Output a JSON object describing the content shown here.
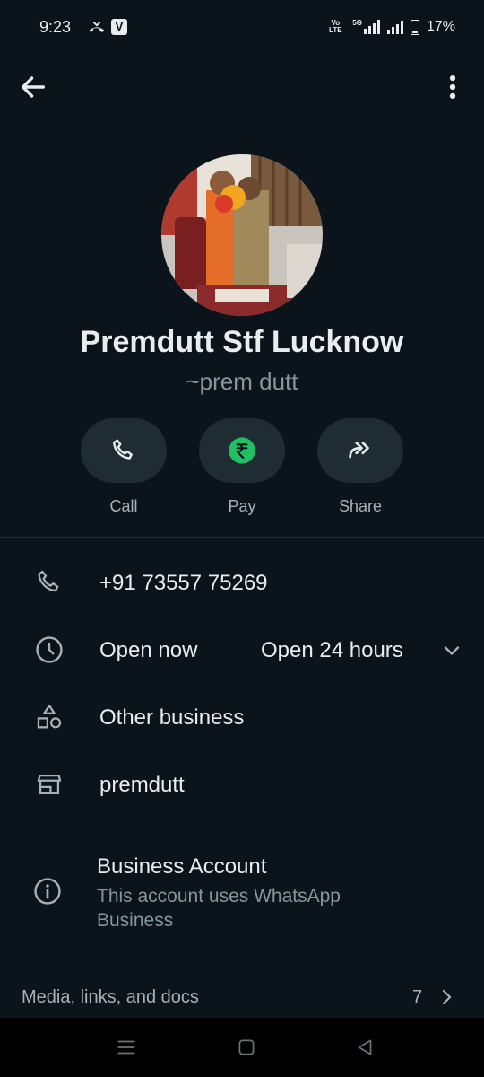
{
  "status_bar": {
    "time": "9:23",
    "network_label": "5G",
    "volte_label": "Vo LTE",
    "battery": "17%"
  },
  "profile": {
    "name": "Premdutt Stf Lucknow",
    "push_name": "~prem dutt"
  },
  "actions": [
    {
      "label": "Call",
      "icon": "phone-icon"
    },
    {
      "label": "Pay",
      "icon": "rupee-icon"
    },
    {
      "label": "Share",
      "icon": "share-forward-icon"
    }
  ],
  "details": {
    "phone": "+91 73557 75269",
    "open_status": "Open now",
    "hours": "Open 24 hours",
    "category": "Other business",
    "store": "premdutt",
    "business_title": "Business Account",
    "business_sub": "This account uses WhatsApp Business"
  },
  "media": {
    "label": "Media, links, and docs",
    "count": "7"
  },
  "colors": {
    "background": "#0b141a",
    "accent_green": "#21c063",
    "pill_bg": "#1f2c33",
    "muted_text": "#8696a0"
  }
}
